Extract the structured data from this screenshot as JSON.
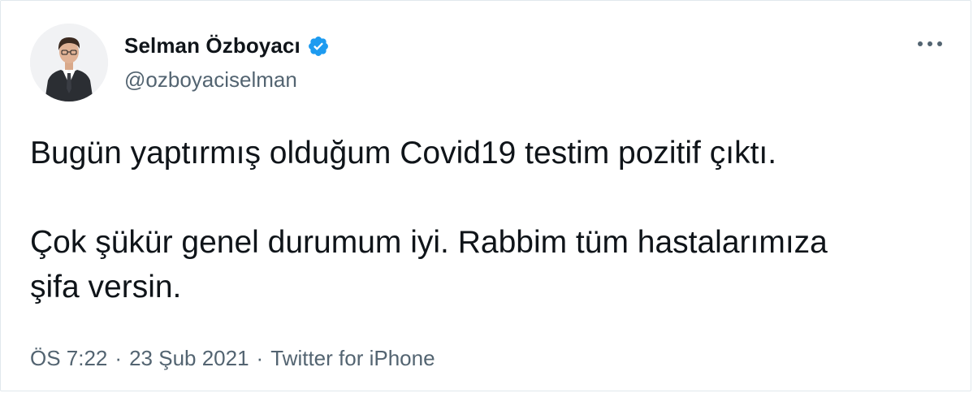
{
  "author": {
    "display_name": "Selman Özboyacı",
    "handle": "@ozboyaciselman",
    "verified": true,
    "avatar_icon": "profile-photo"
  },
  "tweet": {
    "line1": "Bugün yaptırmış olduğum Covid19 testim pozitif çıktı.",
    "line2": "Çok şükür genel durumum iyi. Rabbim tüm hastalarımıza",
    "line3": "şifa versin."
  },
  "meta": {
    "time": "ÖS 7:22",
    "separator": "·",
    "date": "23 Şub 2021",
    "source": "Twitter for iPhone"
  },
  "icons": {
    "verified": "verified-badge-icon",
    "more": "more-options-icon"
  },
  "colors": {
    "verified_blue": "#1d9bf0",
    "secondary_text": "#536471",
    "primary_text": "#0f1419",
    "border": "#e1e8ed"
  }
}
